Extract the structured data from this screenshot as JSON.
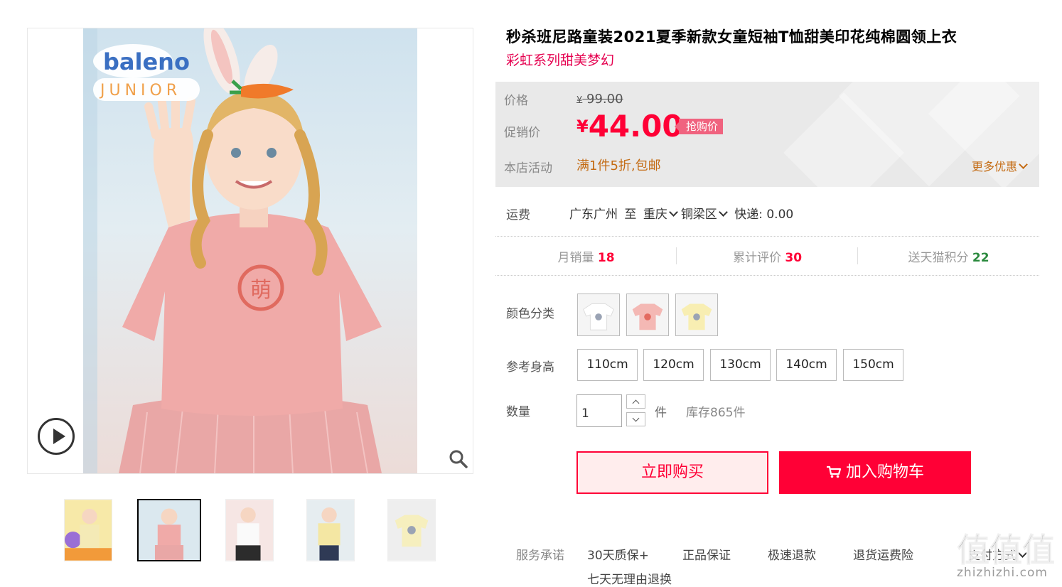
{
  "product": {
    "title": "秒杀班尼路童装2021夏季新款女童短袖T恤甜美印花纯棉圆领上衣",
    "subtitle": "彩虹系列甜美梦幻"
  },
  "price": {
    "label_price": "价格",
    "currency": "¥",
    "original": "99.00",
    "label_promo": "促销价",
    "promo": "44.00",
    "promo_tag": "抢购价",
    "label_activity": "本店活动",
    "activity": "满1件5折,包邮",
    "more_offers": "更多优惠"
  },
  "shipping": {
    "label": "运费",
    "from": "广东广州",
    "to_word": "至",
    "city": "重庆",
    "district": "铜梁区",
    "express": "快递: 0.00"
  },
  "stats": {
    "monthly_sales_label": "月销量",
    "monthly_sales": "18",
    "reviews_label": "累计评价",
    "reviews": "30",
    "points_label": "送天猫积分",
    "points": "22"
  },
  "sku": {
    "color_label": "颜色分类",
    "colors": [
      {
        "name": "white",
        "hex": "#ffffff"
      },
      {
        "name": "pink",
        "hex": "#f4b8b4"
      },
      {
        "name": "yellow",
        "hex": "#f8eeb2"
      }
    ],
    "height_label": "参考身高",
    "sizes": [
      "110cm",
      "120cm",
      "130cm",
      "140cm",
      "150cm"
    ],
    "qty_label": "数量",
    "qty": "1",
    "qty_unit": "件",
    "stock": "库存865件"
  },
  "actions": {
    "buy_now": "立即购买",
    "add_to_cart": "加入购物车"
  },
  "service": {
    "label": "服务承诺",
    "items": [
      "30天质保+",
      "正品保证",
      "极速退款",
      "退货运费险",
      "支付方式"
    ],
    "item_row2": "七天无理由退换"
  },
  "gallery": {
    "logo_top": "baleno",
    "logo_bottom": "JUNIOR",
    "thumbs": [
      "yellow-tee-balloon",
      "pink-tee",
      "white-tee",
      "yellow-tee",
      "yellow-tee-flat"
    ]
  },
  "watermark": {
    "text": "zhizhizhi.com",
    "logo": "值值值"
  },
  "colors": {
    "accent": "#ff0036",
    "title_accent": "#e5004f",
    "activity": "#c46b13",
    "points": "#2b8a3e"
  }
}
